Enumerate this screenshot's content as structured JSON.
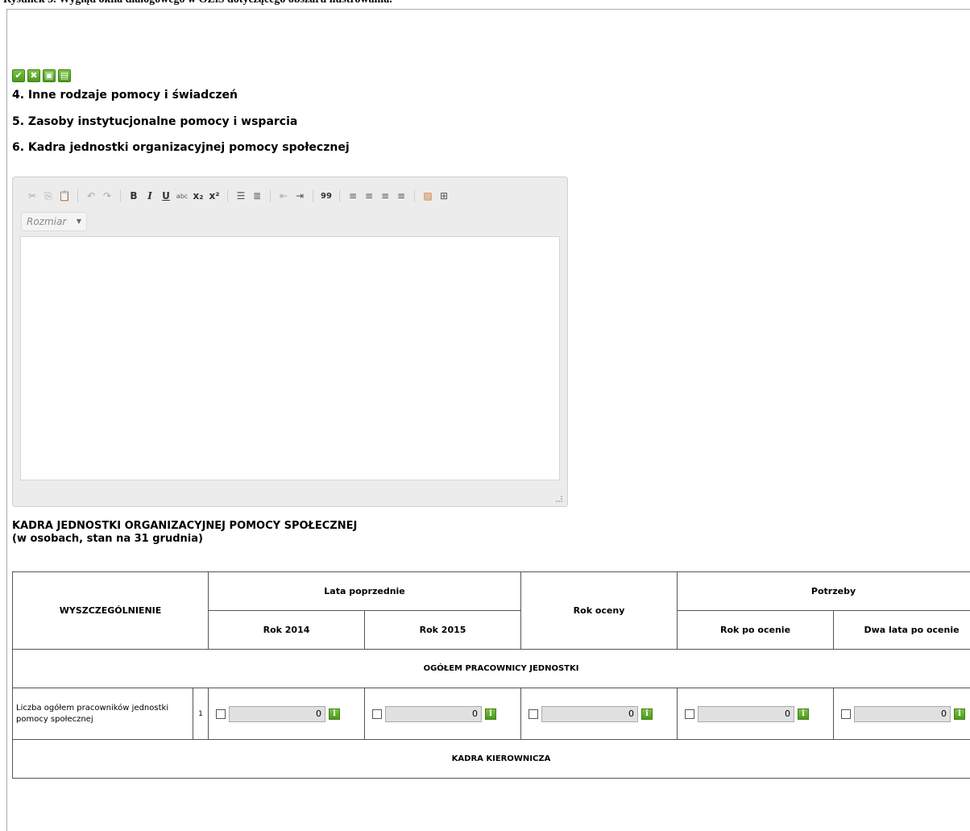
{
  "caption": "Rysunek 5. Wygląd okna dialogowego w OZiS dotyczącego obszaru ilustrowania.",
  "actions": {
    "accept": "✔",
    "cancel": "✖",
    "save": "▣",
    "print": "▤"
  },
  "sections": [
    "4. Inne rodzaje pomocy i świadczeń",
    "5. Zasoby instytucjonalne pomocy i wsparcia",
    "6. Kadra jednostki organizacyjnej pomocy społecznej"
  ],
  "editor": {
    "toolbar": {
      "bold": "B",
      "italic": "I",
      "underline": "U",
      "strike": "abc",
      "subscript": "x₂",
      "superscript": "x²",
      "quote": "99"
    },
    "size_placeholder": "Rozmiar",
    "size_arrow": "▼"
  },
  "table_title": {
    "line1": "KADRA JEDNOSTKI ORGANIZACYJNEJ POMOCY SPOŁECZNEJ",
    "line2": "(w osobach, stan na 31 grudnia)"
  },
  "table": {
    "col_header": "WYSZCZEGÓLNIENIE",
    "group_prev": "Lata poprzednie",
    "year_2014": "Rok 2014",
    "year_2015": "Rok 2015",
    "rok_oceny": "Rok oceny",
    "group_needs": "Potrzeby",
    "rok_po": "Rok po ocenie",
    "dwa_lata": "Dwa lata po ocenie",
    "section1": "OGÓŁEM PRACOWNICY JEDNOSTKI",
    "row1_label": "Liczba ogółem pracowników jednostki pomocy społecznej",
    "row1_num": "1",
    "row1_values": [
      "0",
      "0",
      "0",
      "0",
      "0"
    ],
    "info_glyph": "i",
    "section2": "KADRA KIEROWNICZA"
  }
}
